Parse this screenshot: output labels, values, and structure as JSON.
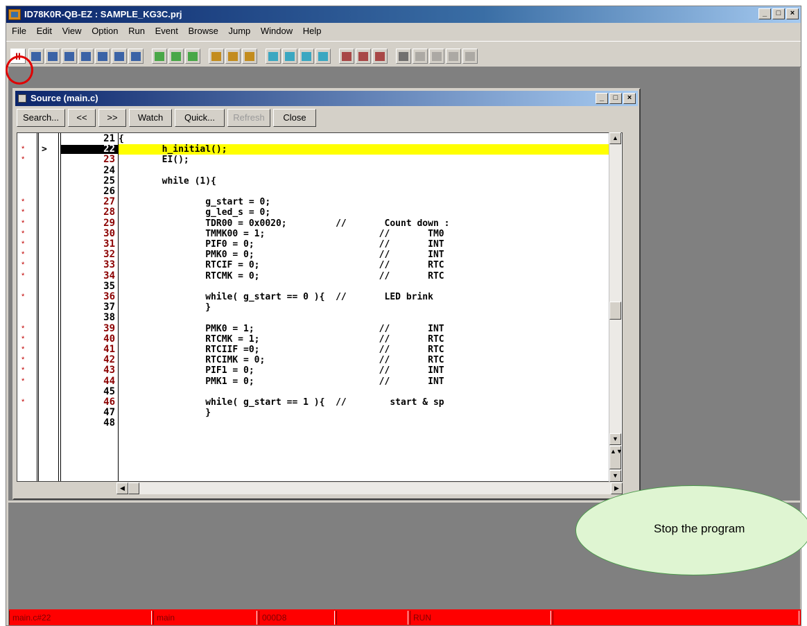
{
  "window": {
    "title": "ID78K0R-QB-EZ : SAMPLE_KG3C.prj"
  },
  "menu": [
    "File",
    "Edit",
    "View",
    "Option",
    "Run",
    "Event",
    "Browse",
    "Jump",
    "Window",
    "Help"
  ],
  "toolbar": {
    "stop_glyph": "II",
    "buttons": [
      "stop-icon",
      "step-in-icon",
      "go-icon",
      "start-from-here-icon",
      "return-out-icon",
      "step-over-icon",
      "run-to-end-icon",
      "restart-icon",
      "source-icon",
      "assemble-icon",
      "memory-icon",
      "register-icon",
      "sfr-icon",
      "local-var-icon",
      "watch-icon",
      "stack-icon",
      "event-icon",
      "timer-icon",
      "trace-icon",
      "snap-icon",
      "stub-icon",
      "console-icon",
      "alert-icon",
      "break-icon",
      "coverage-icon",
      "debug-icon"
    ]
  },
  "source_window": {
    "title": "Source (main.c)",
    "buttons": {
      "search": "Search...",
      "prev": "<<",
      "next": ">>",
      "watch": "Watch",
      "quick": "Quick...",
      "refresh": "Refresh",
      "close": "Close"
    },
    "lines": [
      {
        "num": "21",
        "text": "{",
        "mark": false
      },
      {
        "num": "22",
        "text": "        h_initial();",
        "mark": true,
        "current": true
      },
      {
        "num": "23",
        "text": "        EI();",
        "mark": true
      },
      {
        "num": "24",
        "text": "",
        "mark": false
      },
      {
        "num": "25",
        "text": "        while (1){",
        "mark": false
      },
      {
        "num": "26",
        "text": "",
        "mark": false
      },
      {
        "num": "27",
        "text": "                g_start = 0;",
        "mark": true
      },
      {
        "num": "28",
        "text": "                g_led_s = 0;",
        "mark": true
      },
      {
        "num": "29",
        "text": "                TDR00 = 0x0020;         //       Count down :",
        "mark": true
      },
      {
        "num": "30",
        "text": "                TMMK00 = 1;                     //       TM0",
        "mark": true
      },
      {
        "num": "31",
        "text": "                PIF0 = 0;                       //       INT",
        "mark": true
      },
      {
        "num": "32",
        "text": "                PMK0 = 0;                       //       INT",
        "mark": true
      },
      {
        "num": "33",
        "text": "                RTCIF = 0;                      //       RTC",
        "mark": true
      },
      {
        "num": "34",
        "text": "                RTCMK = 0;                      //       RTC",
        "mark": true
      },
      {
        "num": "35",
        "text": "",
        "mark": false
      },
      {
        "num": "36",
        "text": "                while( g_start == 0 ){  //       LED brink",
        "mark": true
      },
      {
        "num": "37",
        "text": "                }",
        "mark": false
      },
      {
        "num": "38",
        "text": "",
        "mark": false
      },
      {
        "num": "39",
        "text": "                PMK0 = 1;                       //       INT",
        "mark": true
      },
      {
        "num": "40",
        "text": "                RTCMK = 1;                      //       RTC",
        "mark": true
      },
      {
        "num": "41",
        "text": "                RTCIIF =0;                      //       RTC",
        "mark": true
      },
      {
        "num": "42",
        "text": "                RTCIMK = 0;                     //       RTC",
        "mark": true
      },
      {
        "num": "43",
        "text": "                PIF1 = 0;                       //       INT",
        "mark": true
      },
      {
        "num": "44",
        "text": "                PMK1 = 0;                       //       INT",
        "mark": true
      },
      {
        "num": "45",
        "text": "",
        "mark": false
      },
      {
        "num": "46",
        "text": "                while( g_start == 1 ){  //        start & sp",
        "mark": true
      },
      {
        "num": "47",
        "text": "                }",
        "mark": false
      },
      {
        "num": "48",
        "text": "",
        "mark": false
      }
    ],
    "current_arrow": ">",
    "break_mark": "*"
  },
  "callout": {
    "text": "Stop the program"
  },
  "statusbar": {
    "cells": [
      "main.c#22",
      "main",
      "000D8",
      "",
      "RUN",
      ""
    ]
  },
  "colors": {
    "highlight": "#ffff00",
    "status_bg": "#ff0000",
    "callout_bg": "#dff5d2",
    "circle": "#e00000"
  }
}
